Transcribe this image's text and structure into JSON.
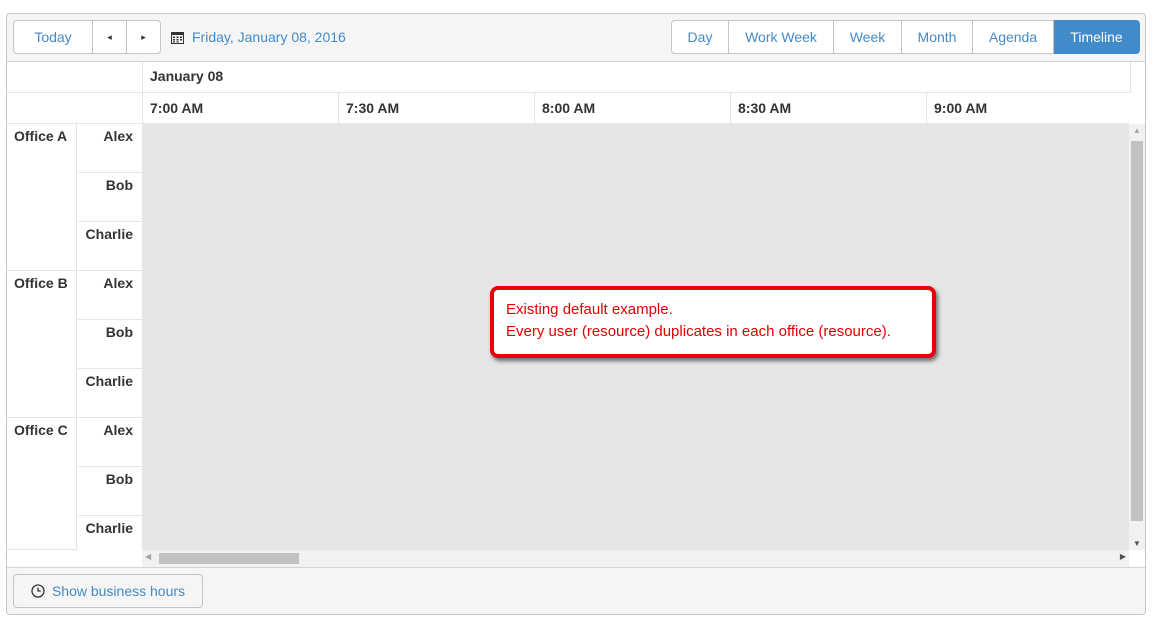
{
  "toolbar": {
    "today_label": "Today",
    "prev_icon": "◂",
    "next_icon": "▸",
    "current_date": "Friday, January 08, 2016",
    "views": [
      {
        "label": "Day"
      },
      {
        "label": "Work Week"
      },
      {
        "label": "Week"
      },
      {
        "label": "Month"
      },
      {
        "label": "Agenda"
      },
      {
        "label": "Timeline",
        "selected": true
      }
    ]
  },
  "timeline": {
    "date_header": "January 08",
    "time_slots": [
      "7:00 AM",
      "7:30 AM",
      "8:00 AM",
      "8:30 AM",
      "9:00 AM"
    ]
  },
  "resources": {
    "offices": [
      {
        "name": "Office A",
        "people": [
          "Alex",
          "Bob",
          "Charlie"
        ]
      },
      {
        "name": "Office B",
        "people": [
          "Alex",
          "Bob",
          "Charlie"
        ]
      },
      {
        "name": "Office C",
        "people": [
          "Alex",
          "Bob",
          "Charlie"
        ]
      }
    ]
  },
  "footer": {
    "business_hours_label": "Show business hours"
  },
  "callout": {
    "line1": "Existing default example.",
    "line2": "Every user (resource) duplicates in each office (resource)."
  },
  "colors": {
    "accent": "#428bca",
    "callout_border": "#e8000b",
    "grid_background": "#e6e6e6"
  }
}
